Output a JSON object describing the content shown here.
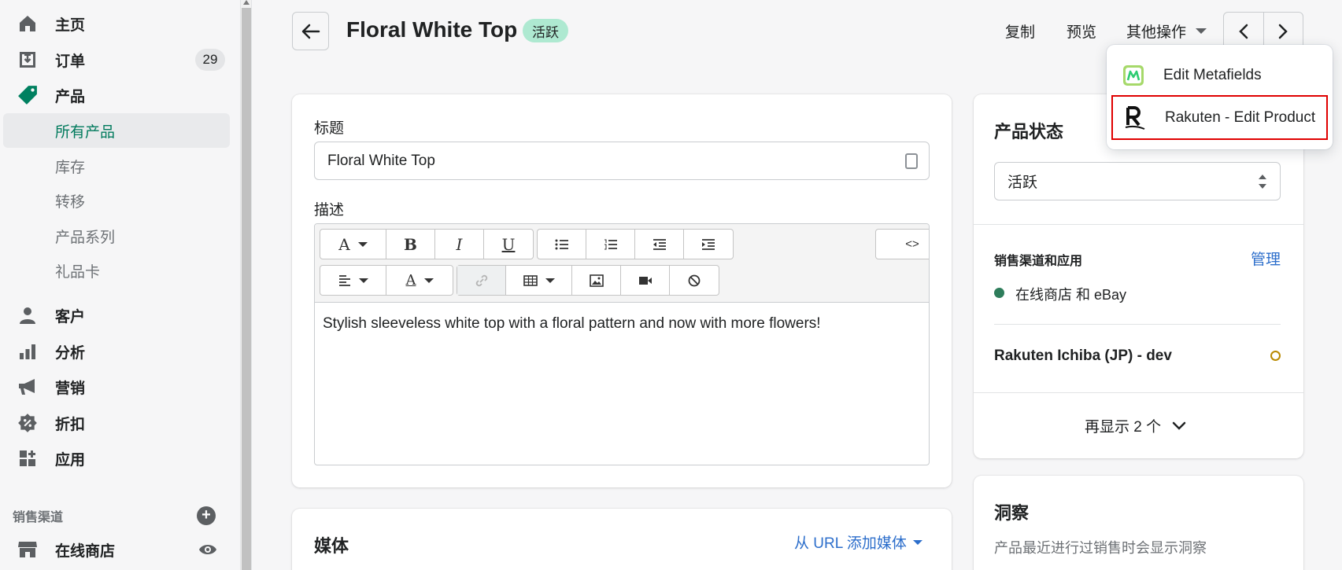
{
  "sidebar": {
    "home": "主页",
    "orders": "订单",
    "orders_count": "29",
    "products": "产品",
    "sub": {
      "all_products": "所有产品",
      "inventory": "库存",
      "transfers": "转移",
      "collections": "产品系列",
      "gift_cards": "礼品卡"
    },
    "customers": "客户",
    "analytics": "分析",
    "marketing": "营销",
    "discounts": "折扣",
    "apps": "应用",
    "sales_channels": "销售渠道",
    "online_store": "在线商店"
  },
  "header": {
    "title": "Floral White Top",
    "status": "活跃",
    "duplicate": "复制",
    "preview": "预览",
    "more_actions": "其他操作"
  },
  "dropdown": {
    "items": [
      {
        "label": "Edit Metafields",
        "icon": "metafields-app-icon"
      },
      {
        "label": "Rakuten - Edit Product",
        "icon": "rakuten-r-icon"
      }
    ]
  },
  "product_form": {
    "title_label": "标题",
    "title_value": "Floral White Top",
    "description_label": "描述",
    "description_value": "Stylish sleeveless white top with a floral pattern and now with more flowers!",
    "source_button": "<>"
  },
  "media": {
    "heading": "媒体",
    "add_from_url": "从 URL 添加媒体"
  },
  "status_card": {
    "heading": "产品状态",
    "select_value": "活跃",
    "channels_label": "销售渠道和应用",
    "manage": "管理",
    "channel_online": "在线商店 和 eBay",
    "rakuten_channel": "Rakuten Ichiba (JP) - dev",
    "show_more": "再显示 2 个"
  },
  "insights": {
    "heading": "洞察",
    "text": "产品最近进行过销售时会显示洞察"
  },
  "colors": {
    "accent_green": "#007a5c",
    "link_blue": "#2c6ecb",
    "status_green": "#2e7d5b",
    "pending_orange": "#b98900",
    "highlight_red": "#e00000"
  }
}
